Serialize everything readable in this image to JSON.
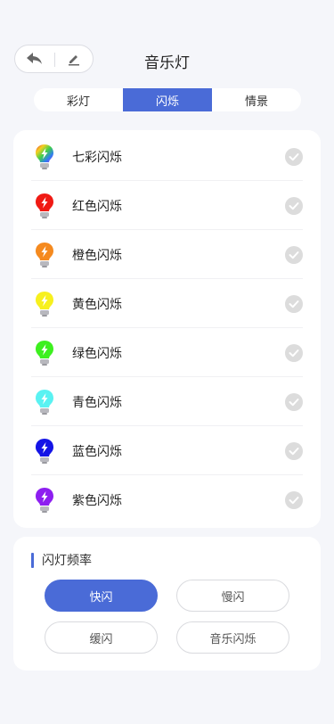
{
  "header": {
    "title": "音乐灯"
  },
  "tabs": [
    {
      "label": "彩灯",
      "active": false
    },
    {
      "label": "闪烁",
      "active": true
    },
    {
      "label": "情景",
      "active": false
    }
  ],
  "effects": [
    {
      "label": "七彩闪烁",
      "color": "rainbow",
      "icon": "rainbow-bulb-icon"
    },
    {
      "label": "红色闪烁",
      "color": "#f01a14",
      "icon": "red-bulb-icon"
    },
    {
      "label": "橙色闪烁",
      "color": "#f58a1f",
      "icon": "orange-bulb-icon"
    },
    {
      "label": "黄色闪烁",
      "color": "#f7f01e",
      "icon": "yellow-bulb-icon"
    },
    {
      "label": "绿色闪烁",
      "color": "#3df01f",
      "icon": "green-bulb-icon"
    },
    {
      "label": "青色闪烁",
      "color": "#5af2f2",
      "icon": "cyan-bulb-icon"
    },
    {
      "label": "蓝色闪烁",
      "color": "#1414e6",
      "icon": "blue-bulb-icon"
    },
    {
      "label": "紫色闪烁",
      "color": "#8d1ef0",
      "icon": "purple-bulb-icon"
    }
  ],
  "frequency": {
    "title": "闪灯频率",
    "options": [
      {
        "label": "快闪",
        "active": true
      },
      {
        "label": "慢闪",
        "active": false
      },
      {
        "label": "缓闪",
        "active": false
      },
      {
        "label": "音乐闪烁",
        "active": false
      }
    ]
  },
  "colors": {
    "accent": "#4a6bd7",
    "check": "#dcdcdc"
  }
}
